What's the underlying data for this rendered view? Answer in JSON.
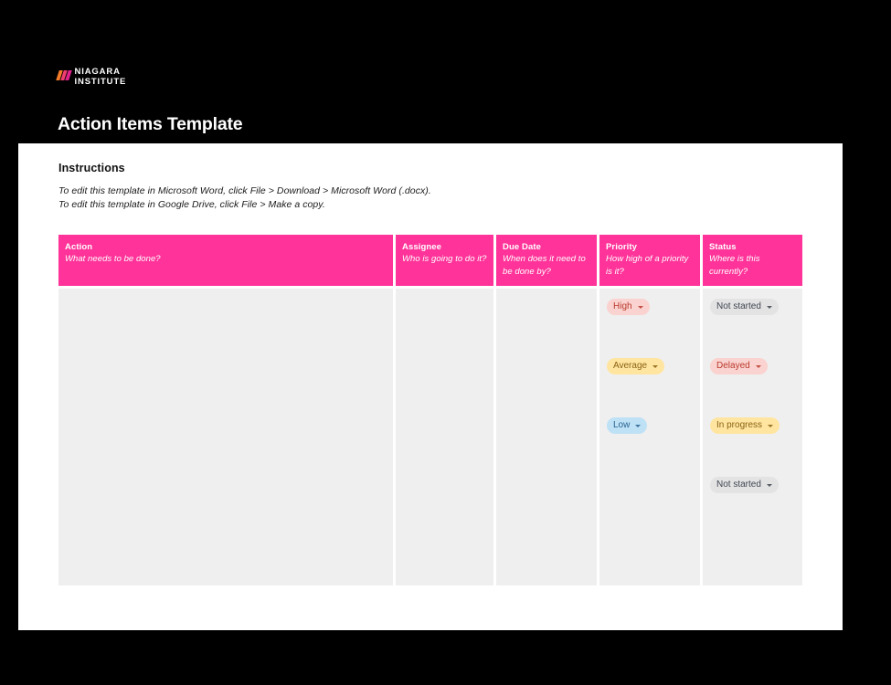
{
  "brand": {
    "logo_line1": "NIAGARA",
    "logo_line2": "INSTITUTE",
    "slash_colors": [
      "#f47b2a",
      "#ef3d6e",
      "#e0208c"
    ]
  },
  "header": {
    "title": "Action Items Template"
  },
  "instructions": {
    "heading": "Instructions",
    "line1": "To edit this template in Microsoft Word, click File > Download > Microsoft Word (.docx).",
    "line2": "To edit this template in Google Drive, click File > Make a copy."
  },
  "theme": {
    "page_background": "#000000",
    "card_background": "#ffffff",
    "header_row": "#ff3399",
    "cell_background": "#efefef"
  },
  "table": {
    "columns": [
      {
        "name": "Action",
        "hint": "What needs to be done?"
      },
      {
        "name": "Assignee",
        "hint": "Who is going to do it?"
      },
      {
        "name": "Due Date",
        "hint": "When does it need to be done by?"
      },
      {
        "name": "Priority",
        "hint": "How high of a priority is it?"
      },
      {
        "name": "Status",
        "hint": "Where is this currently?"
      }
    ],
    "rows": [
      {
        "action": "",
        "assignee": "",
        "due_date": "",
        "priority": {
          "label": "High",
          "style": "chip-red"
        },
        "status": {
          "label": "Not started",
          "style": "chip-gray"
        }
      },
      {
        "action": "",
        "assignee": "",
        "due_date": "",
        "priority": {
          "label": "Average",
          "style": "chip-yellow"
        },
        "status": {
          "label": "Delayed",
          "style": "chip-red"
        }
      },
      {
        "action": "",
        "assignee": "",
        "due_date": "",
        "priority": {
          "label": "Low",
          "style": "chip-blue"
        },
        "status": {
          "label": "In progress",
          "style": "chip-yellow"
        }
      },
      {
        "action": "",
        "assignee": "",
        "due_date": "",
        "priority": {
          "label": "",
          "style": "chip-empty"
        },
        "status": {
          "label": "Not started",
          "style": "chip-gray"
        }
      },
      {
        "action": "",
        "assignee": "",
        "due_date": "",
        "priority": {
          "label": "",
          "style": "chip-empty"
        },
        "status": {
          "label": "",
          "style": "chip-empty"
        }
      }
    ]
  }
}
